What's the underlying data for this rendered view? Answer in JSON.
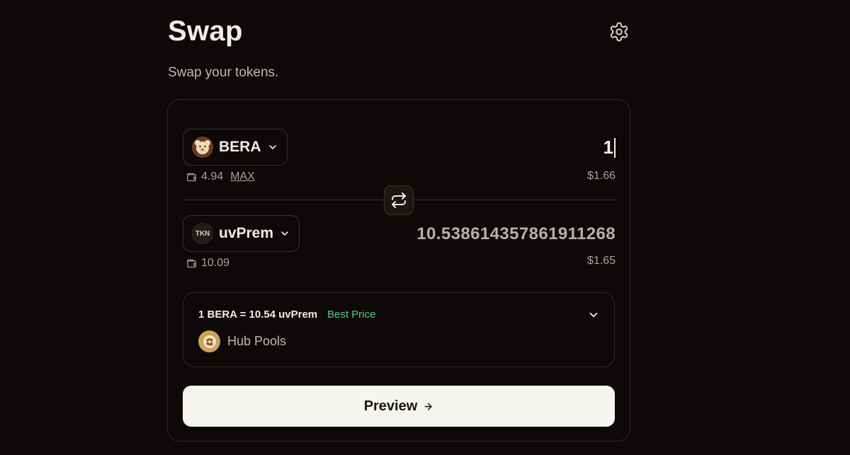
{
  "header": {
    "title": "Swap",
    "subtitle": "Swap your tokens.",
    "settings_icon": "gear-icon"
  },
  "from": {
    "symbol": "BERA",
    "icon": "bera-token-icon",
    "balance": "4.94",
    "max_label": "MAX",
    "amount": "1",
    "usd_value": "$1.66"
  },
  "to": {
    "symbol": "uvPrem",
    "icon_text": "TKN",
    "balance": "10.09",
    "amount": "10.538614357861911268",
    "usd_value": "$1.65"
  },
  "route": {
    "rate_left": "1 BERA = 10.54",
    "rate_right": "uvPrem",
    "best_label": "Best Price",
    "pool_name": "Hub Pools"
  },
  "actions": {
    "preview_label": "Preview"
  },
  "colors": {
    "background": "#0d0908",
    "best_price": "#4fcf7c",
    "button_bg": "#f6f4f1"
  }
}
